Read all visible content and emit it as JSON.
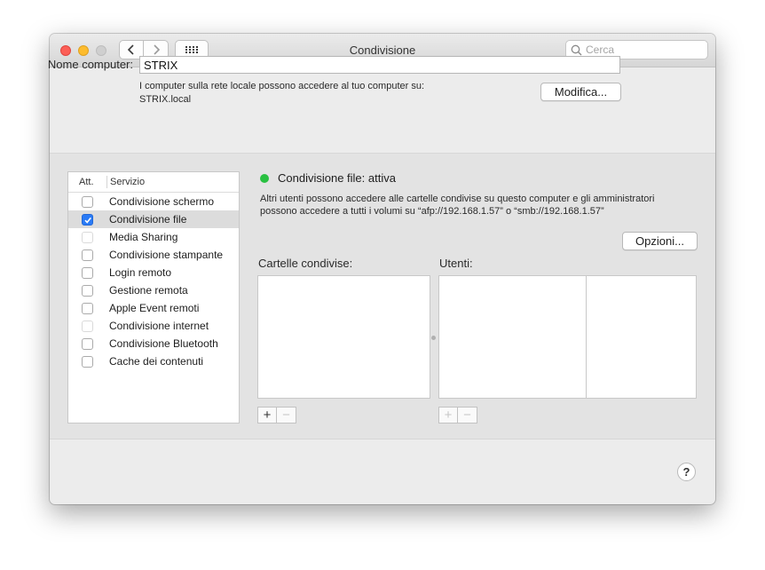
{
  "window": {
    "title": "Condivisione"
  },
  "toolbar": {
    "search_placeholder": "Cerca"
  },
  "computer": {
    "name_label": "Nome computer:",
    "name_value": "STRIX",
    "note_line1": "I computer sulla rete locale possono accedere al tuo computer su:",
    "note_line2": "STRIX.local",
    "edit_button": "Modifica..."
  },
  "services": {
    "header_on": "Att.",
    "header_service": "Servizio",
    "items": [
      {
        "label": "Condivisione schermo",
        "checked": false,
        "enabled": true,
        "selected": false
      },
      {
        "label": "Condivisione file",
        "checked": true,
        "enabled": true,
        "selected": true
      },
      {
        "label": "Media Sharing",
        "checked": false,
        "enabled": false,
        "selected": false
      },
      {
        "label": "Condivisione stampante",
        "checked": false,
        "enabled": true,
        "selected": false
      },
      {
        "label": "Login remoto",
        "checked": false,
        "enabled": true,
        "selected": false
      },
      {
        "label": "Gestione remota",
        "checked": false,
        "enabled": true,
        "selected": false
      },
      {
        "label": "Apple Event remoti",
        "checked": false,
        "enabled": true,
        "selected": false
      },
      {
        "label": "Condivisione internet",
        "checked": false,
        "enabled": false,
        "selected": false
      },
      {
        "label": "Condivisione Bluetooth",
        "checked": false,
        "enabled": true,
        "selected": false
      },
      {
        "label": "Cache dei contenuti",
        "checked": false,
        "enabled": true,
        "selected": false
      }
    ]
  },
  "detail": {
    "status_text": "Condivisione file: attiva",
    "status_color": "#29c041",
    "description_line1": "Altri utenti possono accedere alle cartelle condivise su questo computer e gli amministratori",
    "description_line2": "possono accedere a tutti i volumi su “afp://192.168.1.57” o “smb://192.168.1.57”",
    "options_button": "Opzioni...",
    "shared_folders_label": "Cartelle condivise:",
    "users_label": "Utenti:",
    "add_symbol": "+",
    "remove_symbol": "−"
  },
  "help": {
    "symbol": "?"
  },
  "colors": {
    "accent": "#2a7bf6",
    "selected_row": "#dcdcdc"
  }
}
